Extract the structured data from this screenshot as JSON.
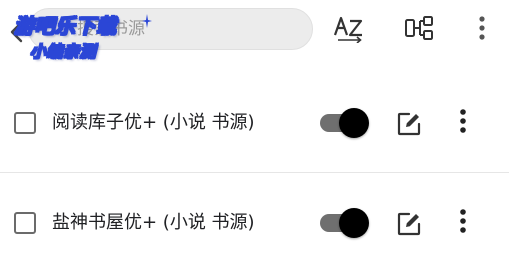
{
  "colors": {
    "background": "#ffffff",
    "search_fill": "#ececec",
    "text": "#202124",
    "switch_track": "#6f6f6f",
    "switch_thumb": "#000000",
    "watermark_stroke": "#2b46d6"
  },
  "toolbar": {
    "back_icon": "chevron-left-icon",
    "search_placeholder": "搜索书源",
    "search_value": "",
    "sort_icon": "sort-az-icon",
    "group_icon": "group-tree-icon",
    "more_icon": "more-vert-icon"
  },
  "watermark": {
    "line1": "游吧乐下载",
    "line2": "小编亲测"
  },
  "sources": [
    {
      "name": "阅读库子优+ (小说 书源)",
      "enabled": true,
      "checked": false
    },
    {
      "name": "盐神书屋优+ (小说 书源)",
      "enabled": true,
      "checked": false
    }
  ],
  "row_icons": {
    "edit": "edit-icon",
    "more": "more-vert-icon"
  }
}
